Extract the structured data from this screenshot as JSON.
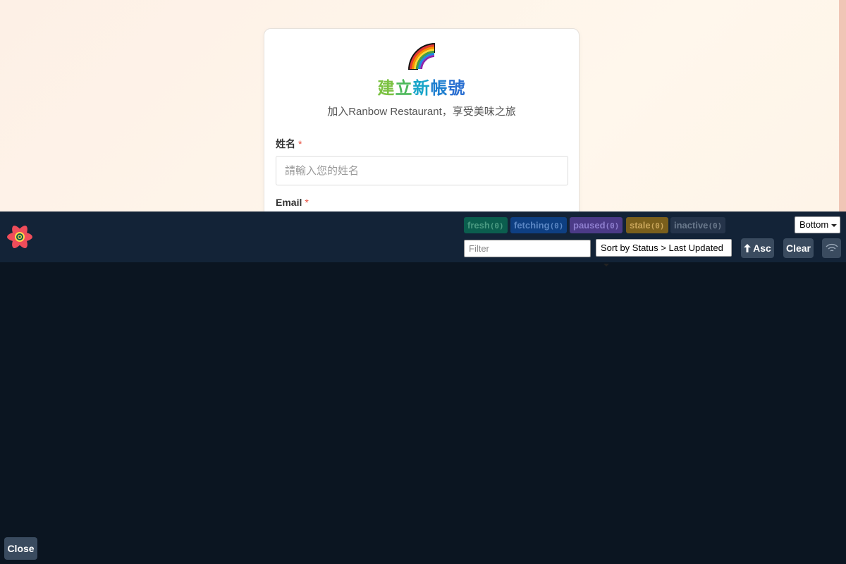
{
  "form": {
    "title_chars": [
      "建",
      "立",
      "新",
      "帳",
      "號"
    ],
    "title_colors": [
      "#7cc243",
      "#4cb85a",
      "#19a5c9",
      "#1f7fd0",
      "#2a6fd1"
    ],
    "subtitle": "加入Ranbow Restaurant，享受美味之旅",
    "name_label": "姓名",
    "name_required": "*",
    "name_placeholder": "請輸入您的姓名",
    "email_label": "Email",
    "email_required": "*"
  },
  "devtools": {
    "badges": [
      {
        "label": "fresh",
        "count": "(0)"
      },
      {
        "label": "fetching",
        "count": "(0)"
      },
      {
        "label": "paused",
        "count": "(0)"
      },
      {
        "label": "stale",
        "count": "(0)"
      },
      {
        "label": "inactive",
        "count": "(0)"
      }
    ],
    "position_select": "Bottom",
    "filter_placeholder": "Filter",
    "sort_select": "Sort by Status > Last Updated",
    "asc_label": "Asc",
    "clear_label": "Clear",
    "close_label": "Close"
  }
}
